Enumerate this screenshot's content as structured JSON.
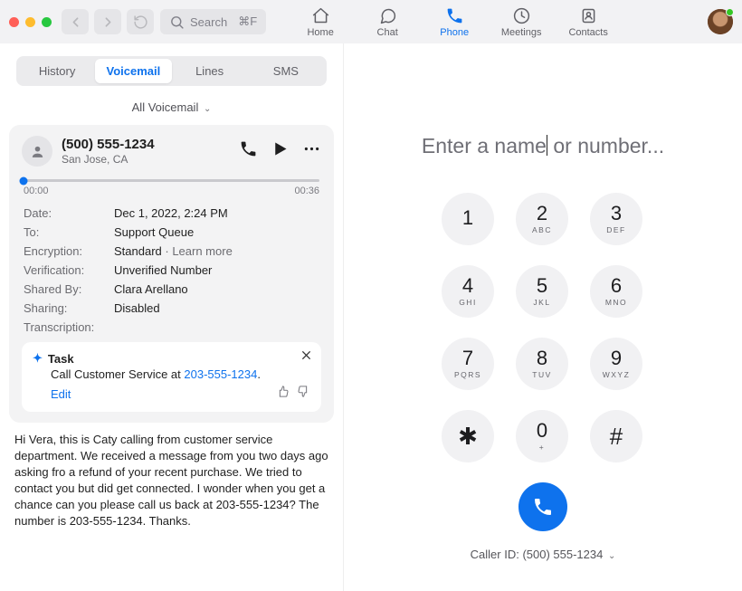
{
  "toolbar": {
    "traffic": {
      "red": "#ff5f57",
      "amber": "#febc2e",
      "green": "#28c840"
    },
    "search_placeholder": "Search",
    "search_kbd": "⌘F",
    "nav": [
      {
        "label": "Home"
      },
      {
        "label": "Chat"
      },
      {
        "label": "Phone"
      },
      {
        "label": "Meetings"
      },
      {
        "label": "Contacts"
      }
    ],
    "active_nav_index": 2
  },
  "subtabs": [
    "History",
    "Voicemail",
    "Lines",
    "SMS"
  ],
  "active_subtab_index": 1,
  "all_vm_label": "All Voicemail",
  "voicemail": {
    "number": "(500) 555-1234",
    "location": "San Jose, CA",
    "time_start": "00:00",
    "time_end": "00:36",
    "meta": {
      "date_k": "Date:",
      "date_v": "Dec 1, 2022, 2:24 PM",
      "to_k": "To:",
      "to_v": "Support Queue",
      "enc_k": "Encryption:",
      "enc_v": "Standard",
      "enc_learn": " · Learn more",
      "ver_k": "Verification:",
      "ver_v": "Unverified Number",
      "shby_k": "Shared By:",
      "shby_v": "Clara Arellano",
      "sh_k": "Sharing:",
      "sh_v": "Disabled",
      "tr_k": "Transcription:"
    },
    "task": {
      "title": "Task",
      "body_pre": "Call Customer Service at ",
      "body_phone": "203-555-1234",
      "body_post": ".",
      "edit": "Edit"
    },
    "transcript": "Hi Vera, this is Caty calling from customer service department. We received a message from you two days ago asking fro a refund of your recent purchase. We tried to contact you but did get connected. I wonder when you get a chance can you please call us back at 203-555-1234? The number is 203-555-1234. Thanks."
  },
  "dialer": {
    "placeholder_pre": "Enter a name",
    "placeholder_post": " or number...",
    "keys": [
      {
        "n": "1",
        "l": ""
      },
      {
        "n": "2",
        "l": "ABC"
      },
      {
        "n": "3",
        "l": "DEF"
      },
      {
        "n": "4",
        "l": "GHI"
      },
      {
        "n": "5",
        "l": "JKL"
      },
      {
        "n": "6",
        "l": "MNO"
      },
      {
        "n": "7",
        "l": "PQRS"
      },
      {
        "n": "8",
        "l": "TUV"
      },
      {
        "n": "9",
        "l": "WXYZ"
      },
      {
        "n": "✱",
        "l": ""
      },
      {
        "n": "0",
        "l": "+"
      },
      {
        "n": "#",
        "l": ""
      }
    ],
    "caller_id_label": "Caller ID: ",
    "caller_id_value": "(500) 555-1234"
  }
}
